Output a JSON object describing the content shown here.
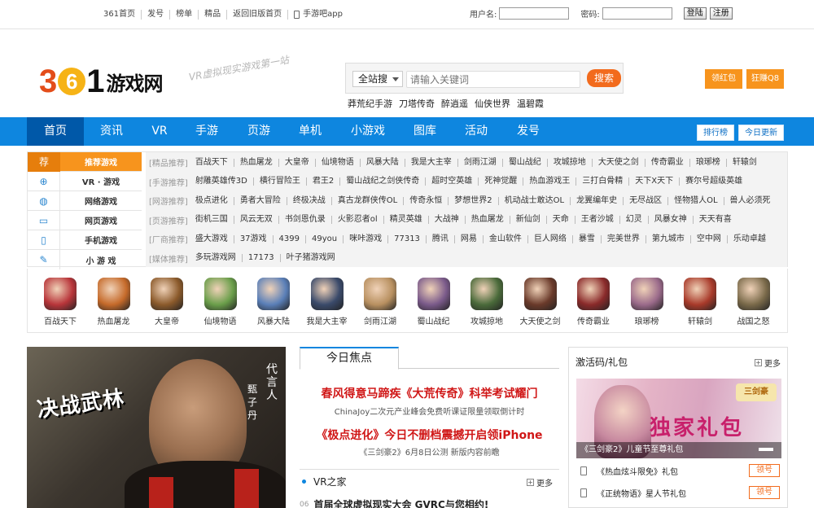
{
  "topbar": {
    "links": [
      "361首页",
      "发号",
      "榜单",
      "精品",
      "返回旧版首页",
      "手游吧app"
    ],
    "username_label": "用户名:",
    "password_label": "密码:",
    "login_label": "登陆",
    "register_label": "注册"
  },
  "header": {
    "logo_num3": "3",
    "logo_num6": "6",
    "logo_num1": "1",
    "logo_name": "游戏网",
    "slogan": "VR虚拟现实游戏第一站",
    "search": {
      "scope": "全站搜",
      "placeholder": "请输入关键词",
      "button": "搜索"
    },
    "hotwords": [
      "莽荒纪手游",
      "刀塔传奇",
      "醉逍遥",
      "仙侠世界",
      "温碧霞"
    ],
    "btn_redpacket": "领红包",
    "btn_earn": "狂赚Q8"
  },
  "nav": {
    "items": [
      "首页",
      "资讯",
      "VR",
      "手游",
      "页游",
      "单机",
      "小游戏",
      "图库",
      "活动",
      "发号"
    ],
    "ranking": "排行榜",
    "today_update": "今日更新"
  },
  "categories": {
    "left": [
      "推荐游戏",
      "VR · 游戏",
      "网络游戏",
      "网页游戏",
      "手机游戏",
      "小 游 戏"
    ],
    "icons": [
      "star-icon",
      "gamepad-icon",
      "globe-icon",
      "browser-icon",
      "phone-icon",
      "carrot-icon"
    ],
    "rows": [
      {
        "label": "[精品推荐]",
        "items": [
          "百战天下",
          "热血屠龙",
          "大皇帝",
          "仙境物语",
          "风暴大陆",
          "我是大主宰",
          "剑雨江湖",
          "蜀山战纪",
          "攻城掠地",
          "大天使之剑",
          "传奇霸业",
          "琅琊榜",
          "轩辕剑"
        ]
      },
      {
        "label": "[手游推荐]",
        "items": [
          "射雕英雄传3D",
          "横行冒险王",
          "君王2",
          "蜀山战纪之剑侠传奇",
          "超时空英雄",
          "死神觉醒",
          "热血游戏王",
          "三打白骨精",
          "天下X天下",
          "赛尔号超级英雄"
        ]
      },
      {
        "label": "[网游推荐]",
        "items": [
          "极点进化",
          "勇者大冒险",
          "终极决战",
          "真古龙群侠传OL",
          "传奇永恒",
          "梦想世界2",
          "机动战士敢达OL",
          "龙翼编年史",
          "无尽战区",
          "怪物猎人OL",
          "兽人必须死"
        ]
      },
      {
        "label": "[页游推荐]",
        "items": [
          "街机三国",
          "风云无双",
          "书剑恩仇录",
          "火影忍者ol",
          "精灵英雄",
          "大战神",
          "热血屠龙",
          "新仙剑",
          "天命",
          "王者沙城",
          "幻灵",
          "风暴女神",
          "天天有喜"
        ]
      },
      {
        "label": "[厂商推荐]",
        "items": [
          "盛大游戏",
          "37游戏",
          "4399",
          "49you",
          "咪咔游戏",
          "77313",
          "腾讯",
          "网易",
          "金山软件",
          "巨人网络",
          "暴雪",
          "完美世界",
          "第九城市",
          "空中网",
          "乐动卓越"
        ]
      },
      {
        "label": "[媒体推荐]",
        "items": [
          "多玩游戏网",
          "17173",
          "叶子猪游戏网"
        ]
      }
    ]
  },
  "game_icons": {
    "names": [
      "百战天下",
      "热血屠龙",
      "大皇帝",
      "仙境物语",
      "风暴大陆",
      "我是大主宰",
      "剑雨江湖",
      "蜀山战纪",
      "攻城掠地",
      "大天使之剑",
      "传奇霸业",
      "琅琊榜",
      "轩辕剑",
      "战国之怒"
    ],
    "colors": [
      "#b8353a",
      "#c56a2a",
      "#8b5a2b",
      "#6a9e4a",
      "#5a7fb8",
      "#3a4a6a",
      "#b89060",
      "#7a5a8a",
      "#4a6a3a",
      "#6a3a2a",
      "#8a2a2a",
      "#9a6a8a",
      "#a83a2a",
      "#7a6a4a"
    ]
  },
  "banner": {
    "title": "决战武林",
    "spokes_label": "代言人",
    "spokes_name": "甄子丹"
  },
  "focus": {
    "tab": "今日焦点",
    "headline1": "春风得意马蹄疾《大荒传奇》科举考试耀门",
    "sub1": "ChinaJoy二次元产业峰会免费听课证限量领取倒计时",
    "headline2": "《极点进化》今日不删档震撼开启领iPhone",
    "sub2": "《三剑豪2》6月8日公测 新版内容前瞻",
    "vr_title": "VR之家",
    "more": "更多",
    "vr_item_num": "06",
    "vr_item": "首届全球虚拟现实大会 GVRC与您相约!"
  },
  "gift": {
    "title": "激活码/礼包",
    "more": "更多",
    "image_logo": "三剑豪",
    "image_text": "独家礼包",
    "caption": "《三剑豪2》儿童节至尊礼包",
    "rows": [
      {
        "name": "《热血炫斗限免》礼包",
        "btn": "领号"
      },
      {
        "name": "《正统物语》星人节礼包",
        "btn": "领号"
      }
    ]
  }
}
